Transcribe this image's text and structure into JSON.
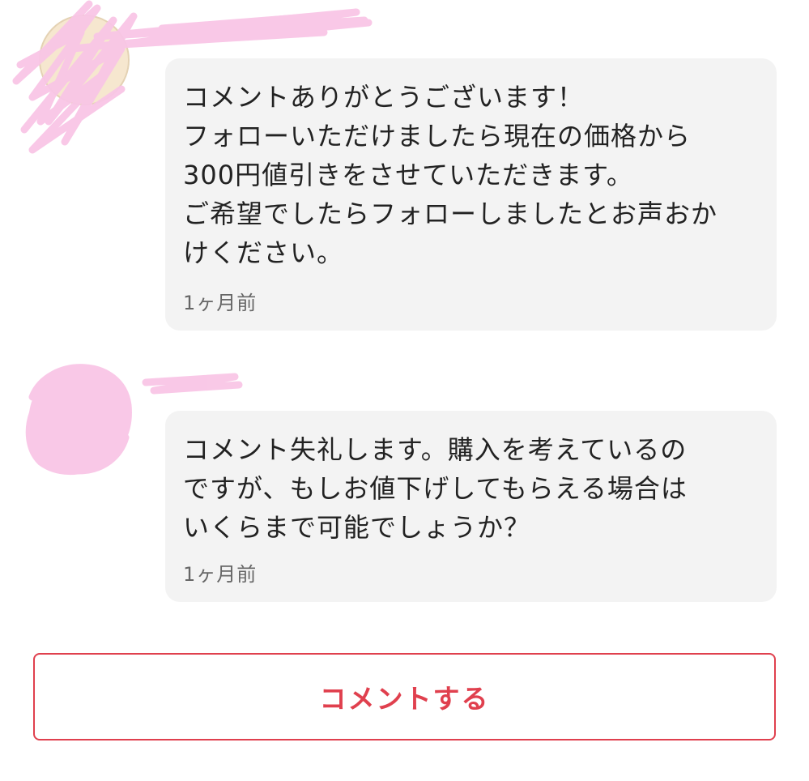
{
  "comments": [
    {
      "text": "コメントありがとうございます！\nフォローいただけましたら現在の価格から\n300円値引きをさせていただきます。\nご希望でしたらフォローしましたとお声おか\nけください。",
      "time": "1ヶ月前"
    },
    {
      "text": "コメント失礼します。購入を考えているの\nですが、もしお値下げしてもらえる場合は\nいくらまで可能でしょうか？",
      "time": "1ヶ月前"
    }
  ],
  "action": {
    "comment_button_label": "コメントする"
  },
  "colors": {
    "accent": "#e0404e",
    "bubble_bg": "#f3f3f3",
    "redaction": "#f9c6e6"
  }
}
